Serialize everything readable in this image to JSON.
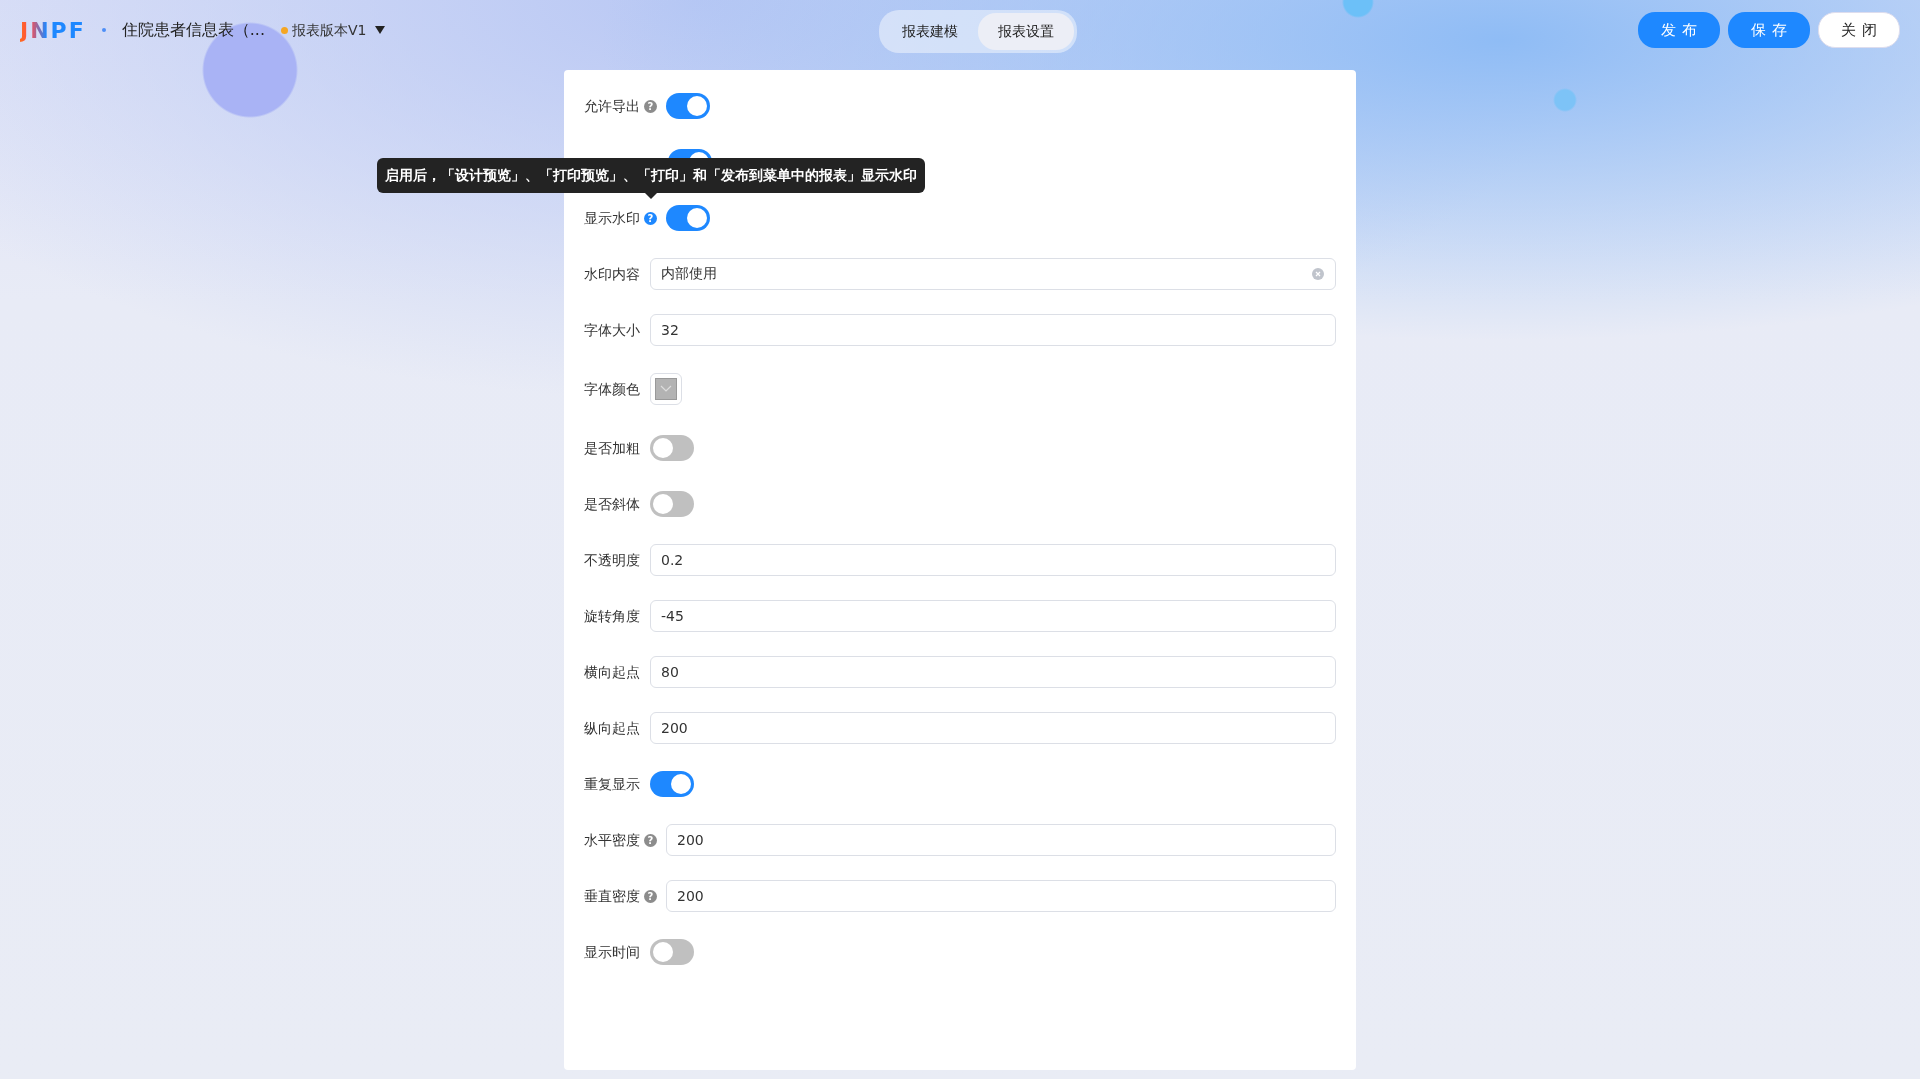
{
  "header": {
    "logo": "JNPF",
    "title": "住院患者信息表（...",
    "version": {
      "label": "报表版本V1"
    },
    "tabs": [
      {
        "label": "报表建模",
        "selected": false
      },
      {
        "label": "报表设置",
        "selected": true
      }
    ],
    "buttons": [
      {
        "label": "发布",
        "kind": "primary"
      },
      {
        "label": "保存",
        "kind": "primary"
      },
      {
        "label": "关闭",
        "kind": "plain"
      }
    ]
  },
  "settings": [
    {
      "kind": "switch",
      "label": "允许导出",
      "help": "?",
      "help_hovered": false,
      "on": true
    },
    {
      "kind": "switch",
      "on": true
    },
    {
      "kind": "switch",
      "label": "显示水印",
      "help": "?",
      "help_hovered": true,
      "on": true,
      "tooltip": "启用后，「设计预览」、「打印预览」、「打印」和「发布到菜单中的报表」显示水印"
    },
    {
      "kind": "input",
      "label": "水印内容",
      "value": "内部使用",
      "clearable": true
    },
    {
      "kind": "input",
      "label": "字体大小",
      "value": "32"
    },
    {
      "kind": "color",
      "label": "字体颜色",
      "color": "#b3b3b3"
    },
    {
      "kind": "switch",
      "label": "是否加粗",
      "on": false
    },
    {
      "kind": "switch",
      "label": "是否斜体",
      "on": false
    },
    {
      "kind": "input",
      "label": "不透明度",
      "value": "0.2"
    },
    {
      "kind": "input",
      "label": "旋转角度",
      "value": "-45"
    },
    {
      "kind": "input",
      "label": "横向起点",
      "value": "80"
    },
    {
      "kind": "input",
      "label": "纵向起点",
      "value": "200"
    },
    {
      "kind": "switch",
      "label": "重复显示",
      "on": true
    },
    {
      "kind": "input",
      "label": "水平密度",
      "help": "?",
      "help_hovered": false,
      "value": "200"
    },
    {
      "kind": "input",
      "label": "垂直密度",
      "help": "?",
      "help_hovered": false,
      "value": "200"
    },
    {
      "kind": "switch",
      "label": "显示时间",
      "on": false
    }
  ]
}
